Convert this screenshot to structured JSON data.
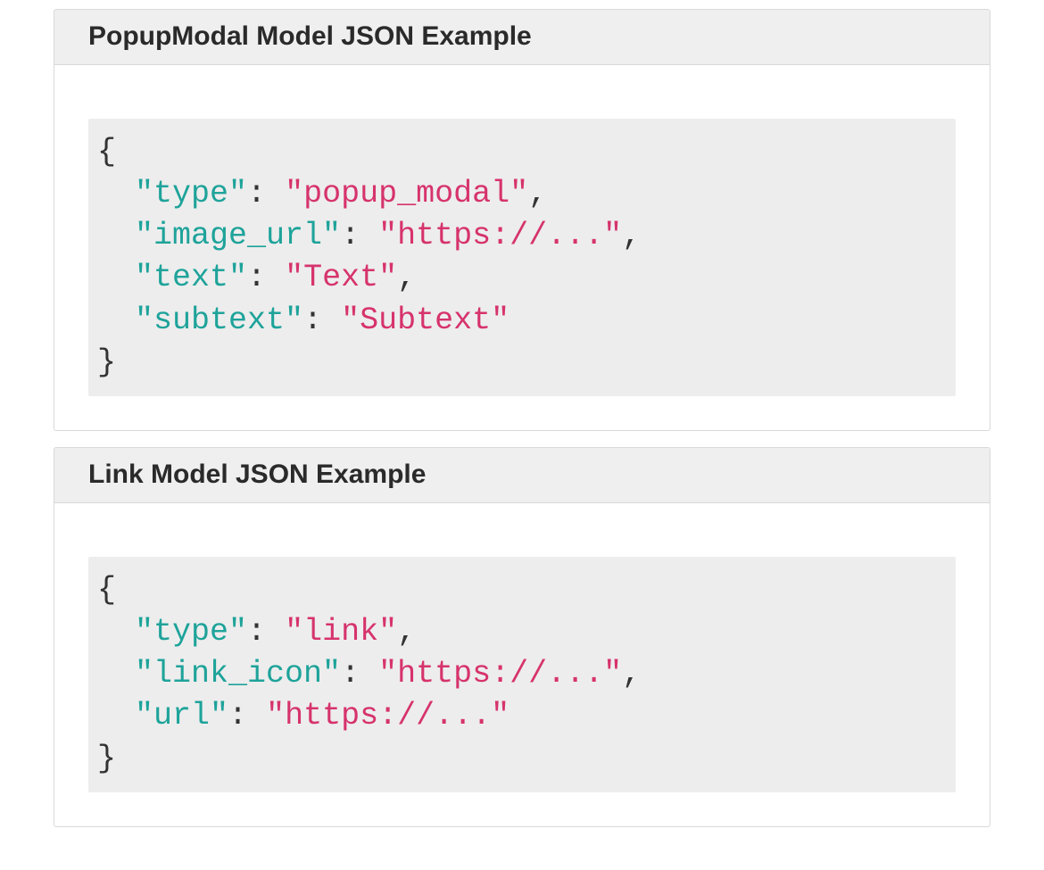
{
  "panels": [
    {
      "title": "PopupModal Model JSON Example",
      "code_tokens": [
        {
          "cls": "tok-punc",
          "text": "{\n"
        },
        {
          "cls": "tok-punc",
          "text": "  "
        },
        {
          "cls": "tok-key",
          "text": "\"type\""
        },
        {
          "cls": "tok-punc",
          "text": ": "
        },
        {
          "cls": "tok-str",
          "text": "\"popup_modal\""
        },
        {
          "cls": "tok-punc",
          "text": ",\n"
        },
        {
          "cls": "tok-punc",
          "text": "  "
        },
        {
          "cls": "tok-key",
          "text": "\"image_url\""
        },
        {
          "cls": "tok-punc",
          "text": ": "
        },
        {
          "cls": "tok-str",
          "text": "\"https://...\""
        },
        {
          "cls": "tok-punc",
          "text": ",\n"
        },
        {
          "cls": "tok-punc",
          "text": "  "
        },
        {
          "cls": "tok-key",
          "text": "\"text\""
        },
        {
          "cls": "tok-punc",
          "text": ": "
        },
        {
          "cls": "tok-str",
          "text": "\"Text\""
        },
        {
          "cls": "tok-punc",
          "text": ",\n"
        },
        {
          "cls": "tok-punc",
          "text": "  "
        },
        {
          "cls": "tok-key",
          "text": "\"subtext\""
        },
        {
          "cls": "tok-punc",
          "text": ": "
        },
        {
          "cls": "tok-str",
          "text": "\"Subtext\""
        },
        {
          "cls": "tok-punc",
          "text": "\n}"
        }
      ]
    },
    {
      "title": "Link Model JSON Example",
      "code_tokens": [
        {
          "cls": "tok-punc",
          "text": "{\n"
        },
        {
          "cls": "tok-punc",
          "text": "  "
        },
        {
          "cls": "tok-key",
          "text": "\"type\""
        },
        {
          "cls": "tok-punc",
          "text": ": "
        },
        {
          "cls": "tok-str",
          "text": "\"link\""
        },
        {
          "cls": "tok-punc",
          "text": ",\n"
        },
        {
          "cls": "tok-punc",
          "text": "  "
        },
        {
          "cls": "tok-key",
          "text": "\"link_icon\""
        },
        {
          "cls": "tok-punc",
          "text": ": "
        },
        {
          "cls": "tok-str",
          "text": "\"https://...\""
        },
        {
          "cls": "tok-punc",
          "text": ",\n"
        },
        {
          "cls": "tok-punc",
          "text": "  "
        },
        {
          "cls": "tok-key",
          "text": "\"url\""
        },
        {
          "cls": "tok-punc",
          "text": ": "
        },
        {
          "cls": "tok-str",
          "text": "\"https://...\""
        },
        {
          "cls": "tok-punc",
          "text": "\n}"
        }
      ]
    }
  ]
}
